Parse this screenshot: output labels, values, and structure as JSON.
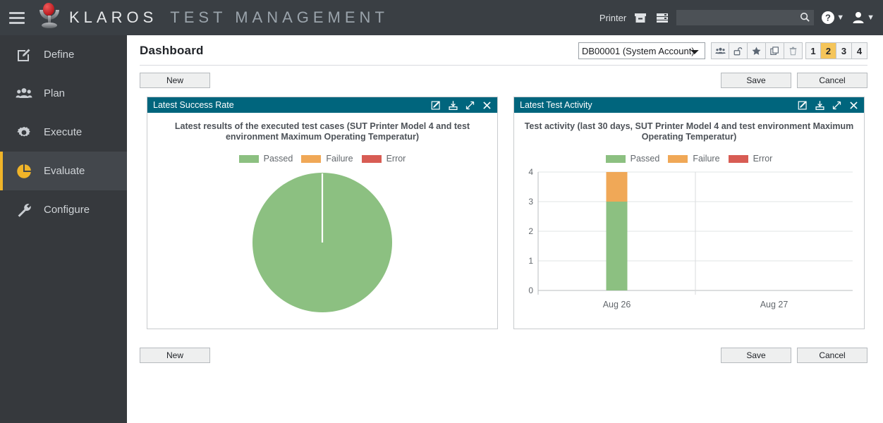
{
  "topbar": {
    "brand_primary": "KLAROS",
    "brand_secondary": "TEST MANAGEMENT",
    "printer_label": "Printer",
    "search_value": "",
    "search_placeholder": "",
    "icons": [
      "menu-icon",
      "klaros-logo-icon",
      "archive-icon",
      "database-icon",
      "search-icon",
      "help-icon",
      "user-icon"
    ]
  },
  "sidebar": {
    "items": [
      {
        "label": "Define",
        "icon": "edit-square-icon",
        "active": false
      },
      {
        "label": "Plan",
        "icon": "people-icon",
        "active": false
      },
      {
        "label": "Execute",
        "icon": "gear-icon",
        "active": false
      },
      {
        "label": "Evaluate",
        "icon": "pie-chart-icon",
        "active": true
      },
      {
        "label": "Configure",
        "icon": "wrench-icon",
        "active": false
      }
    ]
  },
  "page": {
    "title": "Dashboard",
    "selected_object": "DB00001 (System Account)",
    "toolbar_icons": [
      "users-icon",
      "unlock-icon",
      "star-icon",
      "copy-icon",
      "trash-icon"
    ],
    "pages": [
      "1",
      "2",
      "3",
      "4"
    ],
    "current_page": "2"
  },
  "buttons": {
    "new": "New",
    "save": "Save",
    "cancel": "Cancel"
  },
  "widgets": [
    {
      "title": "Latest Success Rate",
      "description": "Latest results of the executed test cases (SUT Printer Model 4 and test environment Maximum Operating Temperatur)",
      "icons": [
        "edit-icon",
        "export-icon",
        "expand-icon",
        "close-icon"
      ]
    },
    {
      "title": "Latest Test Activity",
      "description": "Test activity (last 30 days,  SUT Printer Model 4 and test environment Maximum Operating Temperatur)",
      "icons": [
        "edit-icon",
        "export-icon",
        "expand-icon",
        "close-icon"
      ]
    }
  ],
  "colors": {
    "passed": "#8cc081",
    "failure": "#f0a857",
    "error": "#d85c54",
    "widget_header": "#00657d",
    "accent": "#f0b429",
    "sidebar": "#36393d",
    "topbar": "#3a3f44"
  },
  "legend": [
    {
      "label": "Passed",
      "color": "#8cc081"
    },
    {
      "label": "Failure",
      "color": "#f0a857"
    },
    {
      "label": "Error",
      "color": "#d85c54"
    }
  ],
  "chart_data": [
    {
      "type": "pie",
      "title": "Latest Success Rate",
      "subtitle": "Latest results of the executed test cases (SUT Printer Model 4 and test environment Maximum Operating Temperatur)",
      "labels": [
        "Passed",
        "Failure",
        "Error"
      ],
      "values": [
        100,
        0,
        0
      ],
      "colors": [
        "#8cc081",
        "#f0a857",
        "#d85c54"
      ],
      "legend_position": "top",
      "unit": "%"
    },
    {
      "type": "bar",
      "title": "Latest Test Activity",
      "subtitle": "Test activity (last 30 days,  SUT Printer Model 4 and test environment Maximum Operating Temperatur)",
      "stacked": true,
      "categories": [
        "Aug 26",
        "Aug 27"
      ],
      "series": [
        {
          "name": "Passed",
          "color": "#8cc081",
          "values": [
            3,
            0
          ]
        },
        {
          "name": "Failure",
          "color": "#f0a857",
          "values": [
            1,
            0
          ]
        },
        {
          "name": "Error",
          "color": "#d85c54",
          "values": [
            0,
            0
          ]
        }
      ],
      "xlabel": "",
      "ylabel": "",
      "ylim": [
        0,
        4
      ],
      "yticks": [
        "0",
        "1",
        "2",
        "3",
        "4"
      ],
      "grid": true,
      "legend_position": "top"
    }
  ]
}
